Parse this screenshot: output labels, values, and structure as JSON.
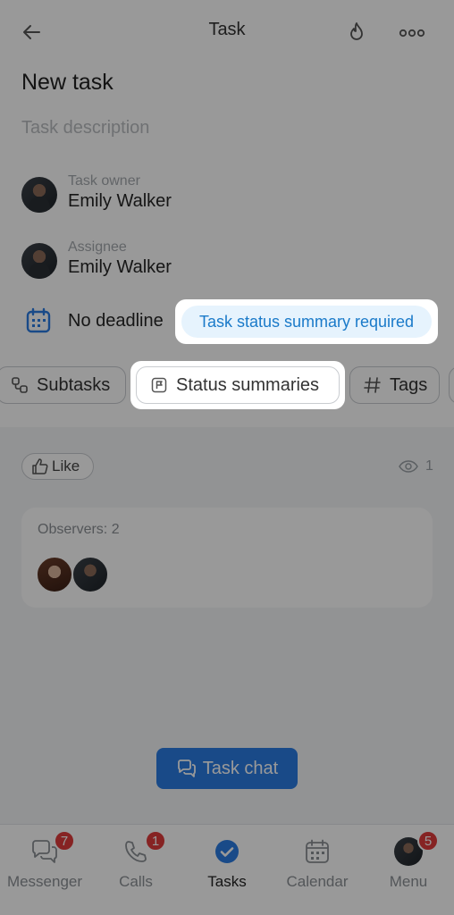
{
  "header": {
    "title": "Task"
  },
  "task": {
    "title": "New task",
    "description_placeholder": "Task description"
  },
  "people": [
    {
      "role": "Task owner",
      "name": "Emily Walker"
    },
    {
      "role": "Assignee",
      "name": "Emily Walker"
    }
  ],
  "deadline": {
    "label": "No deadline",
    "summary_required_label": "Task status summary required"
  },
  "chips": {
    "subtasks": "Subtasks",
    "status_summaries": "Status summaries",
    "tags": "Tags"
  },
  "social": {
    "like_label": "Like",
    "views_count": "1"
  },
  "observers": {
    "label": "Observers: 2"
  },
  "task_chat": {
    "label": "Task chat"
  },
  "tabbar": {
    "items": [
      {
        "label": "Messenger",
        "badge": "7",
        "icon": "chat-icon"
      },
      {
        "label": "Calls",
        "badge": "1",
        "icon": "phone-icon"
      },
      {
        "label": "Tasks",
        "badge": "",
        "icon": "check-circle-icon"
      },
      {
        "label": "Calendar",
        "badge": "",
        "icon": "calendar-icon"
      },
      {
        "label": "Menu",
        "badge": "5",
        "icon": "avatar"
      }
    ]
  },
  "colors": {
    "accent": "#2a7ce3",
    "badge": "#e03b3b",
    "highlight_text": "#1a7ac9",
    "highlight_bg": "#e6f3fd"
  }
}
